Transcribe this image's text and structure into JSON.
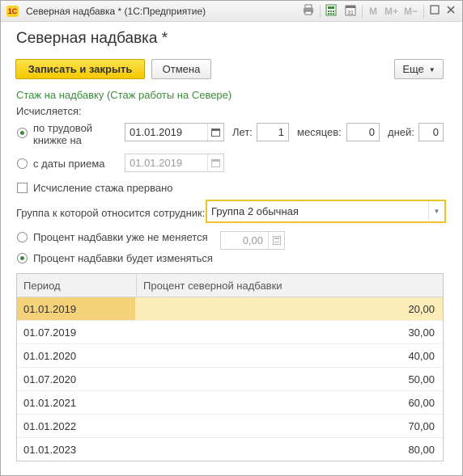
{
  "titlebar": {
    "logo": "1С",
    "title": "Северная надбавка * (1С:Предприятие)",
    "m": "M",
    "m_plus": "M+",
    "m_minus": "M−",
    "icons": [
      "printer-icon",
      "calculator-icon",
      "calendar-icon",
      "restore-icon",
      "close-icon"
    ]
  },
  "form": {
    "title": "Северная надбавка *",
    "save_close_label": "Записать и закрыть",
    "cancel_label": "Отмена",
    "more_label": "Еще",
    "section_title": "Стаж на надбавку (Стаж работы на Севере)",
    "calc_label": "Исчисляется:",
    "radio_work_book_line1": "по трудовой",
    "radio_work_book_line2": "книжке на",
    "work_book_date": "01.01.2019",
    "years_label": "Лет:",
    "years_value": "1",
    "months_label": "месяцев:",
    "months_value": "0",
    "days_label": "дней:",
    "days_value": "0",
    "radio_hire_date_label": "с даты приема",
    "hire_date": "01.01.2019",
    "interrupted_label": "Исчисление стажа прервано",
    "group_label": "Группа к которой относится сотрудник:",
    "group_value": "Группа 2 обычная",
    "pct_fixed_label": "Процент надбавки уже не меняется",
    "pct_fixed_value": "0,00",
    "pct_changes_label": "Процент надбавки будет изменяться"
  },
  "table": {
    "columns": [
      "Период",
      "Процент северной надбавки"
    ],
    "rows": [
      {
        "period": "01.01.2019",
        "pct": "20,00"
      },
      {
        "period": "01.07.2019",
        "pct": "30,00"
      },
      {
        "period": "01.01.2020",
        "pct": "40,00"
      },
      {
        "period": "01.07.2020",
        "pct": "50,00"
      },
      {
        "period": "01.01.2021",
        "pct": "60,00"
      },
      {
        "period": "01.01.2022",
        "pct": "70,00"
      },
      {
        "period": "01.01.2023",
        "pct": "80,00"
      }
    ]
  },
  "colors": {
    "accent_yellow": "#f5c800",
    "section_green": "#3b8d3b",
    "selected_row": "#fbecb8"
  }
}
